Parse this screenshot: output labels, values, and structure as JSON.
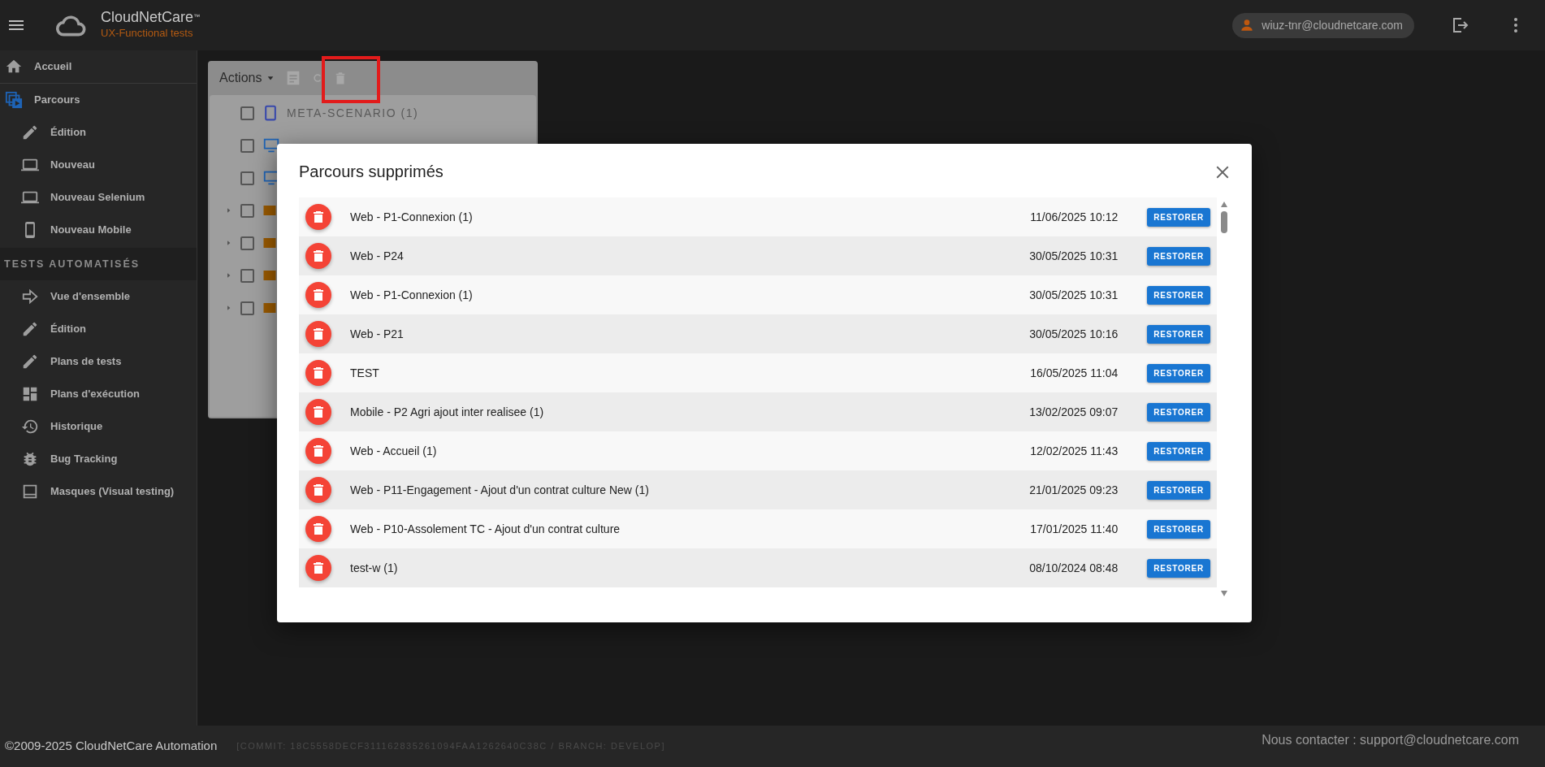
{
  "header": {
    "brand": "CloudNetCare",
    "trademark": "™",
    "subtitle": "UX-Functional tests",
    "user_email": "wiuz-tnr@cloudnetcare.com"
  },
  "sidebar": {
    "items": [
      {
        "kind": "top",
        "label": "Accueil"
      },
      {
        "kind": "top",
        "label": "Parcours"
      },
      {
        "kind": "sub",
        "label": "Édition"
      },
      {
        "kind": "sub",
        "label": "Nouveau"
      },
      {
        "kind": "sub",
        "label": "Nouveau Selenium"
      },
      {
        "kind": "sub",
        "label": "Nouveau Mobile"
      },
      {
        "kind": "section",
        "label": "TESTS AUTOMATISÉS"
      },
      {
        "kind": "sub",
        "label": "Vue d'ensemble"
      },
      {
        "kind": "sub",
        "label": "Édition"
      },
      {
        "kind": "sub",
        "label": "Plans de tests"
      },
      {
        "kind": "sub",
        "label": "Plans d'exécution"
      },
      {
        "kind": "sub",
        "label": "Historique"
      },
      {
        "kind": "sub",
        "label": "Bug Tracking"
      },
      {
        "kind": "sub",
        "label": "Masques (Visual testing)"
      }
    ]
  },
  "panel": {
    "actions_label": "Actions",
    "tree": [
      {
        "kind": "mobile",
        "label": "META-SCENARIO (1)",
        "checked": false,
        "expandable": false
      },
      {
        "kind": "web",
        "checked": false,
        "expandable": false
      },
      {
        "kind": "web",
        "checked": false,
        "expandable": false
      },
      {
        "kind": "folder",
        "checked": false,
        "expandable": true
      },
      {
        "kind": "folder",
        "checked": false,
        "expandable": true
      },
      {
        "kind": "folder",
        "checked": false,
        "expandable": true
      },
      {
        "kind": "folder",
        "checked": false,
        "expandable": true
      }
    ]
  },
  "dialog": {
    "title": "Parcours supprimés",
    "rows": [
      {
        "name": "Web - P1-Connexion (1)",
        "date": "11/06/2025 10:12",
        "action": "RESTORER"
      },
      {
        "name": "Web - P24",
        "date": "30/05/2025 10:31",
        "action": "RESTORER"
      },
      {
        "name": "Web - P1-Connexion (1)",
        "date": "30/05/2025 10:31",
        "action": "RESTORER"
      },
      {
        "name": "Web - P21",
        "date": "30/05/2025 10:16",
        "action": "RESTORER"
      },
      {
        "name": "TEST",
        "date": "16/05/2025 11:04",
        "action": "RESTORER"
      },
      {
        "name": "Mobile - P2 Agri ajout inter realisee (1)",
        "date": "13/02/2025 09:07",
        "action": "RESTORER"
      },
      {
        "name": "Web - Accueil (1)",
        "date": "12/02/2025 11:43",
        "action": "RESTORER"
      },
      {
        "name": "Web - P11-Engagement - Ajout d'un contrat culture New (1)",
        "date": "21/01/2025 09:23",
        "action": "RESTORER"
      },
      {
        "name": "Web - P10-Assolement TC - Ajout d'un contrat culture",
        "date": "17/01/2025 11:40",
        "action": "RESTORER"
      },
      {
        "name": "test-w (1)",
        "date": "08/10/2024 08:48",
        "action": "RESTORER"
      }
    ]
  },
  "footer": {
    "copyright": "©2009-2025 CloudNetCare Automation",
    "build": "[COMMIT: 18C5558DECF311162835261094FAA1262640C38C / BRANCH: DEVELOP]",
    "contact": "Nous contacter : support@cloudnetcare.com"
  }
}
